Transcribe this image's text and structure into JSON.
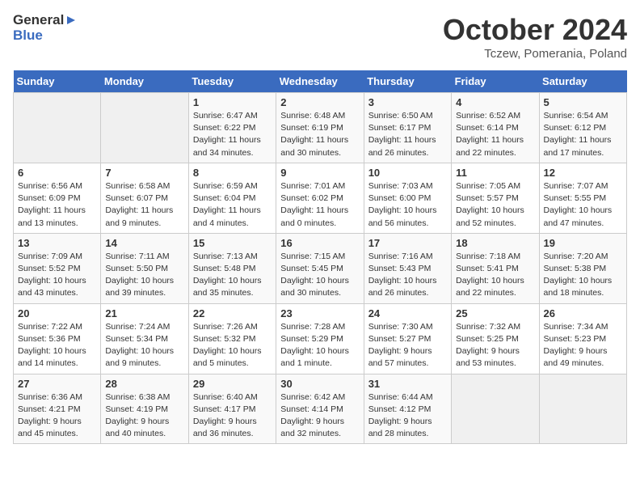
{
  "header": {
    "logo_line1": "General",
    "logo_line2": "Blue",
    "month": "October 2024",
    "location": "Tczew, Pomerania, Poland"
  },
  "days_of_week": [
    "Sunday",
    "Monday",
    "Tuesday",
    "Wednesday",
    "Thursday",
    "Friday",
    "Saturday"
  ],
  "weeks": [
    [
      {
        "day": "",
        "info": ""
      },
      {
        "day": "",
        "info": ""
      },
      {
        "day": "1",
        "info": "Sunrise: 6:47 AM\nSunset: 6:22 PM\nDaylight: 11 hours\nand 34 minutes."
      },
      {
        "day": "2",
        "info": "Sunrise: 6:48 AM\nSunset: 6:19 PM\nDaylight: 11 hours\nand 30 minutes."
      },
      {
        "day": "3",
        "info": "Sunrise: 6:50 AM\nSunset: 6:17 PM\nDaylight: 11 hours\nand 26 minutes."
      },
      {
        "day": "4",
        "info": "Sunrise: 6:52 AM\nSunset: 6:14 PM\nDaylight: 11 hours\nand 22 minutes."
      },
      {
        "day": "5",
        "info": "Sunrise: 6:54 AM\nSunset: 6:12 PM\nDaylight: 11 hours\nand 17 minutes."
      }
    ],
    [
      {
        "day": "6",
        "info": "Sunrise: 6:56 AM\nSunset: 6:09 PM\nDaylight: 11 hours\nand 13 minutes."
      },
      {
        "day": "7",
        "info": "Sunrise: 6:58 AM\nSunset: 6:07 PM\nDaylight: 11 hours\nand 9 minutes."
      },
      {
        "day": "8",
        "info": "Sunrise: 6:59 AM\nSunset: 6:04 PM\nDaylight: 11 hours\nand 4 minutes."
      },
      {
        "day": "9",
        "info": "Sunrise: 7:01 AM\nSunset: 6:02 PM\nDaylight: 11 hours\nand 0 minutes."
      },
      {
        "day": "10",
        "info": "Sunrise: 7:03 AM\nSunset: 6:00 PM\nDaylight: 10 hours\nand 56 minutes."
      },
      {
        "day": "11",
        "info": "Sunrise: 7:05 AM\nSunset: 5:57 PM\nDaylight: 10 hours\nand 52 minutes."
      },
      {
        "day": "12",
        "info": "Sunrise: 7:07 AM\nSunset: 5:55 PM\nDaylight: 10 hours\nand 47 minutes."
      }
    ],
    [
      {
        "day": "13",
        "info": "Sunrise: 7:09 AM\nSunset: 5:52 PM\nDaylight: 10 hours\nand 43 minutes."
      },
      {
        "day": "14",
        "info": "Sunrise: 7:11 AM\nSunset: 5:50 PM\nDaylight: 10 hours\nand 39 minutes."
      },
      {
        "day": "15",
        "info": "Sunrise: 7:13 AM\nSunset: 5:48 PM\nDaylight: 10 hours\nand 35 minutes."
      },
      {
        "day": "16",
        "info": "Sunrise: 7:15 AM\nSunset: 5:45 PM\nDaylight: 10 hours\nand 30 minutes."
      },
      {
        "day": "17",
        "info": "Sunrise: 7:16 AM\nSunset: 5:43 PM\nDaylight: 10 hours\nand 26 minutes."
      },
      {
        "day": "18",
        "info": "Sunrise: 7:18 AM\nSunset: 5:41 PM\nDaylight: 10 hours\nand 22 minutes."
      },
      {
        "day": "19",
        "info": "Sunrise: 7:20 AM\nSunset: 5:38 PM\nDaylight: 10 hours\nand 18 minutes."
      }
    ],
    [
      {
        "day": "20",
        "info": "Sunrise: 7:22 AM\nSunset: 5:36 PM\nDaylight: 10 hours\nand 14 minutes."
      },
      {
        "day": "21",
        "info": "Sunrise: 7:24 AM\nSunset: 5:34 PM\nDaylight: 10 hours\nand 9 minutes."
      },
      {
        "day": "22",
        "info": "Sunrise: 7:26 AM\nSunset: 5:32 PM\nDaylight: 10 hours\nand 5 minutes."
      },
      {
        "day": "23",
        "info": "Sunrise: 7:28 AM\nSunset: 5:29 PM\nDaylight: 10 hours\nand 1 minute."
      },
      {
        "day": "24",
        "info": "Sunrise: 7:30 AM\nSunset: 5:27 PM\nDaylight: 9 hours\nand 57 minutes."
      },
      {
        "day": "25",
        "info": "Sunrise: 7:32 AM\nSunset: 5:25 PM\nDaylight: 9 hours\nand 53 minutes."
      },
      {
        "day": "26",
        "info": "Sunrise: 7:34 AM\nSunset: 5:23 PM\nDaylight: 9 hours\nand 49 minutes."
      }
    ],
    [
      {
        "day": "27",
        "info": "Sunrise: 6:36 AM\nSunset: 4:21 PM\nDaylight: 9 hours\nand 45 minutes."
      },
      {
        "day": "28",
        "info": "Sunrise: 6:38 AM\nSunset: 4:19 PM\nDaylight: 9 hours\nand 40 minutes."
      },
      {
        "day": "29",
        "info": "Sunrise: 6:40 AM\nSunset: 4:17 PM\nDaylight: 9 hours\nand 36 minutes."
      },
      {
        "day": "30",
        "info": "Sunrise: 6:42 AM\nSunset: 4:14 PM\nDaylight: 9 hours\nand 32 minutes."
      },
      {
        "day": "31",
        "info": "Sunrise: 6:44 AM\nSunset: 4:12 PM\nDaylight: 9 hours\nand 28 minutes."
      },
      {
        "day": "",
        "info": ""
      },
      {
        "day": "",
        "info": ""
      }
    ]
  ]
}
